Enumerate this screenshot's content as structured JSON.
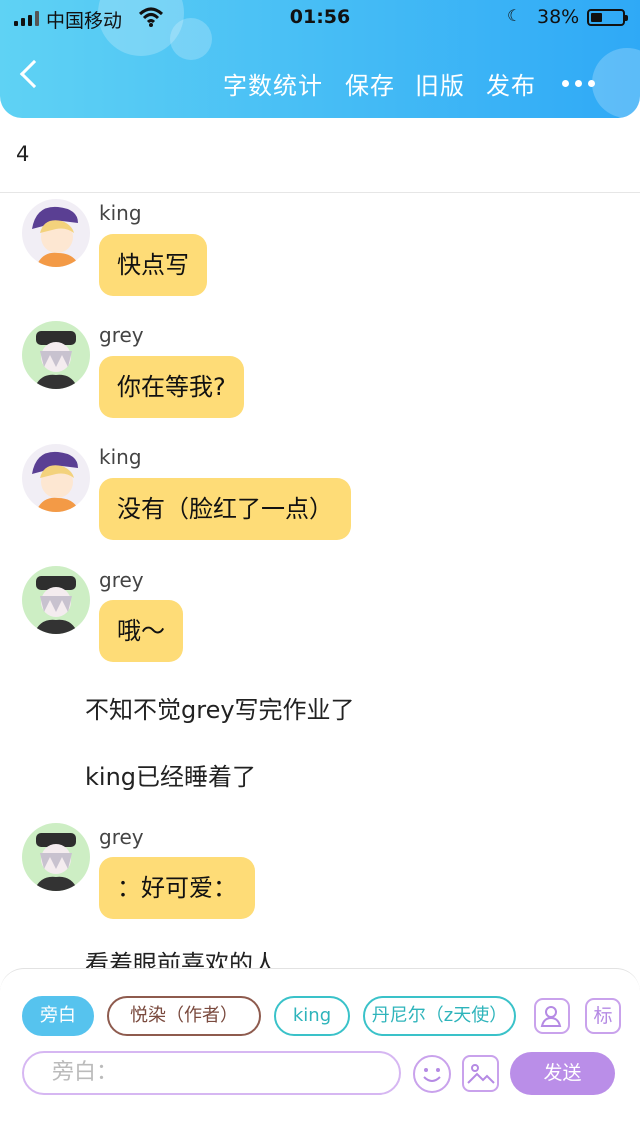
{
  "status_bar": {
    "carrier": "中国移动",
    "time": "01:56",
    "battery": "38%",
    "battery_level": 0.38
  },
  "header": {
    "menu": [
      "字数统计",
      "保存",
      "旧版",
      "发布"
    ]
  },
  "word_count": "4",
  "messages": [
    {
      "type": "chat",
      "name": "king",
      "text": "快点写"
    },
    {
      "type": "chat",
      "name": "grey",
      "text": "你在等我?"
    },
    {
      "type": "chat",
      "name": "king",
      "text": "没有（脸红了一点）"
    },
    {
      "type": "chat",
      "name": "grey",
      "text": "哦～"
    },
    {
      "type": "narration",
      "text": "不知不觉grey写完作业了"
    },
    {
      "type": "narration",
      "text": "king已经睡着了"
    },
    {
      "type": "chat",
      "name": "grey",
      "text": "：好可爱："
    },
    {
      "type": "narration",
      "text": "看着眼前喜欢的人"
    }
  ],
  "roles": [
    "旁白",
    "悦染（作者）",
    "king",
    "丹尼尔（z天使）"
  ],
  "tag_button": "标",
  "input": {
    "placeholder": "旁白："
  },
  "send_label": "发送",
  "colors": {
    "header_start": "#5fd2f4",
    "header_end": "#2fa9f6",
    "bubble": "#fedc77",
    "send": "#ba8ee8"
  }
}
